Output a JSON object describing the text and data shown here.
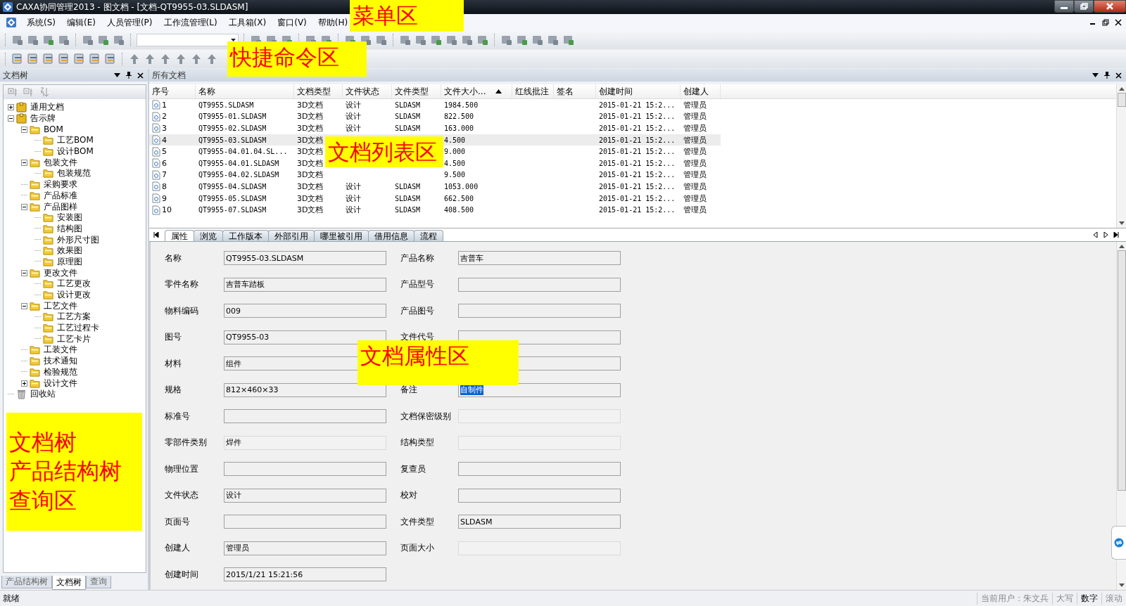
{
  "window": {
    "title": "CAXA协同管理2013 - 图文档 - [文档-QT9955-03.SLDASM]"
  },
  "menu": [
    "系统(S)",
    "编辑(E)",
    "人员管理(P)",
    "工作流管理(L)",
    "工具箱(X)",
    "窗口(V)",
    "帮助(H)"
  ],
  "left_panel": {
    "title": "文档树",
    "tree": [
      {
        "label": "通用文档",
        "kind": "cabinet",
        "expanded": false
      },
      {
        "label": "告示牌",
        "kind": "cabinet",
        "expanded": true,
        "children": [
          {
            "label": "BOM",
            "kind": "folder",
            "expanded": true,
            "children": [
              {
                "label": "工艺BOM",
                "kind": "folder"
              },
              {
                "label": "设计BOM",
                "kind": "folder"
              }
            ]
          },
          {
            "label": "包装文件",
            "kind": "folder",
            "expanded": true,
            "children": [
              {
                "label": "包装规范",
                "kind": "folder"
              }
            ]
          },
          {
            "label": "采购要求",
            "kind": "folder"
          },
          {
            "label": "产品标准",
            "kind": "folder"
          },
          {
            "label": "产品图样",
            "kind": "folder",
            "expanded": true,
            "children": [
              {
                "label": "安装图",
                "kind": "folder"
              },
              {
                "label": "结构图",
                "kind": "folder"
              },
              {
                "label": "外形尺寸图",
                "kind": "folder"
              },
              {
                "label": "效果图",
                "kind": "folder"
              },
              {
                "label": "原理图",
                "kind": "folder"
              }
            ]
          },
          {
            "label": "更改文件",
            "kind": "folder",
            "expanded": true,
            "children": [
              {
                "label": "工艺更改",
                "kind": "folder"
              },
              {
                "label": "设计更改",
                "kind": "folder"
              }
            ]
          },
          {
            "label": "工艺文件",
            "kind": "folder",
            "expanded": true,
            "children": [
              {
                "label": "工艺方案",
                "kind": "folder"
              },
              {
                "label": "工艺过程卡",
                "kind": "folder"
              },
              {
                "label": "工艺卡片",
                "kind": "folder"
              }
            ]
          },
          {
            "label": "工装文件",
            "kind": "folder"
          },
          {
            "label": "技术通知",
            "kind": "folder"
          },
          {
            "label": "检验规范",
            "kind": "folder"
          },
          {
            "label": "设计文件",
            "kind": "folder",
            "expanded": false
          }
        ]
      },
      {
        "label": "回收站",
        "kind": "trash"
      }
    ],
    "tabs": [
      {
        "label": "产品结构树",
        "selected": false
      },
      {
        "label": "文档树",
        "selected": true
      },
      {
        "label": "查询",
        "selected": false
      }
    ]
  },
  "documents": {
    "title": "所有文档",
    "columns": [
      "序号",
      "名称",
      "文档类型",
      "文件状态",
      "文件类型",
      "文件大小...",
      "红线批注",
      "签名",
      "创建时间",
      "创建人"
    ],
    "rows": [
      {
        "selected": false,
        "cells": [
          "1",
          "QT9955.SLDASM",
          "3D文档",
          "设计",
          "SLDASM",
          "1984.500",
          "",
          "",
          "2015-01-21 15:2...",
          "管理员"
        ]
      },
      {
        "selected": false,
        "cells": [
          "2",
          "QT9955-01.SLDASM",
          "3D文档",
          "设计",
          "SLDASM",
          "822.500",
          "",
          "",
          "2015-01-21 15:2...",
          "管理员"
        ]
      },
      {
        "selected": false,
        "cells": [
          "3",
          "QT9955-02.SLDASM",
          "3D文档",
          "设计",
          "SLDASM",
          "163.000",
          "",
          "",
          "2015-01-21 15:2...",
          "管理员"
        ]
      },
      {
        "selected": true,
        "cells": [
          "4",
          "QT9955-03.SLDASM",
          "3D文档",
          "",
          "",
          "4.500",
          "",
          "",
          "2015-01-21 15:2...",
          "管理员"
        ]
      },
      {
        "selected": false,
        "cells": [
          "5",
          "QT9955-04.01.04.SL...",
          "3D文档",
          "",
          "",
          "9.000",
          "",
          "",
          "2015-01-21 15:2...",
          "管理员"
        ]
      },
      {
        "selected": false,
        "cells": [
          "6",
          "QT9955-04.01.SLDASM",
          "3D文档",
          "",
          "",
          "4.500",
          "",
          "",
          "2015-01-21 15:2...",
          "管理员"
        ]
      },
      {
        "selected": false,
        "cells": [
          "7",
          "QT9955-04.02.SLDASM",
          "3D文档",
          "",
          "",
          "9.500",
          "",
          "",
          "2015-01-21 15:2...",
          "管理员"
        ]
      },
      {
        "selected": false,
        "cells": [
          "8",
          "QT9955-04.SLDASM",
          "3D文档",
          "设计",
          "SLDASM",
          "1053.000",
          "",
          "",
          "2015-01-21 15:2...",
          "管理员"
        ]
      },
      {
        "selected": false,
        "cells": [
          "9",
          "QT9955-05.SLDASM",
          "3D文档",
          "设计",
          "SLDASM",
          "662.500",
          "",
          "",
          "2015-01-21 15:2...",
          "管理员"
        ]
      },
      {
        "selected": false,
        "cells": [
          "10",
          "QT9955-07.SLDASM",
          "3D文档",
          "设计",
          "SLDASM",
          "408.500",
          "",
          "",
          "2015-01-21 15:2...",
          "管理员"
        ]
      }
    ]
  },
  "detail_tabs": [
    {
      "label": "属性",
      "selected": true
    },
    {
      "label": "浏览",
      "selected": false
    },
    {
      "label": "工作版本",
      "selected": false
    },
    {
      "label": "外部引用",
      "selected": false
    },
    {
      "label": "哪里被引用",
      "selected": false
    },
    {
      "label": "借用信息",
      "selected": false
    },
    {
      "label": "流程",
      "selected": false
    }
  ],
  "properties": [
    {
      "left": {
        "label": "名称",
        "value": "QT9955-03.SLDASM",
        "disabled": false
      },
      "right": {
        "label": "产品名称",
        "value": "吉普车",
        "disabled": false
      }
    },
    {
      "left": {
        "label": "零件名称",
        "value": "吉普车踏板",
        "disabled": false
      },
      "right": {
        "label": "产品型号",
        "disabled": false
      }
    },
    {
      "left": {
        "label": "物料编码",
        "value": "009",
        "disabled": false
      },
      "right": {
        "label": "产品图号",
        "disabled": false
      }
    },
    {
      "left": {
        "label": "图号",
        "value": "QT9955-03",
        "disabled": false
      },
      "right": {
        "label": "文件代号",
        "disabled": false
      }
    },
    {
      "left": {
        "label": "材料",
        "value": "组件",
        "disabled": false
      },
      "right": {
        "disabled": false
      }
    },
    {
      "left": {
        "label": "规格",
        "value": "812×460×33",
        "disabled": false
      },
      "right": {
        "label": "备注",
        "value": "自制件",
        "disabled": false,
        "highlighted": true
      }
    },
    {
      "left": {
        "label": "标准号",
        "disabled": false
      },
      "right": {
        "label": "文档保密级别",
        "disabled": true
      }
    },
    {
      "left": {
        "label": "零部件类别",
        "value": "焊件",
        "disabled": true
      },
      "right": {
        "label": "结构类型",
        "disabled": true
      }
    },
    {
      "left": {
        "label": "物理位置",
        "disabled": false
      },
      "right": {
        "label": "复查员",
        "disabled": false
      }
    },
    {
      "left": {
        "label": "文件状态",
        "value": "设计",
        "disabled": false
      },
      "right": {
        "label": "校对",
        "disabled": false
      }
    },
    {
      "left": {
        "label": "页面号",
        "disabled": false
      },
      "right": {
        "label": "文件类型",
        "value": "SLDASM",
        "disabled": false
      }
    },
    {
      "left": {
        "label": "创建人",
        "value": "管理员",
        "disabled": false
      },
      "right": {
        "label": "页面大小",
        "disabled": true
      }
    },
    {
      "left": {
        "label": "创建时间",
        "value": "2015/1/21 15:21:56",
        "disabled": false
      }
    }
  ],
  "status_bar": {
    "message": "就绪",
    "user": "当前用户：朱文兵",
    "indicators": [
      {
        "label": "大写",
        "on": false
      },
      {
        "label": "数字",
        "on": true
      },
      {
        "label": "滚动",
        "on": false
      }
    ]
  },
  "annotations": [
    {
      "lines": [
        "菜单区"
      ]
    },
    {
      "lines": [
        "快捷命令区"
      ]
    },
    {
      "lines": [
        "文档列表区"
      ]
    },
    {
      "lines": [
        "文档属性区"
      ]
    },
    {
      "lines": [
        "文档树",
        "产品结构树",
        "查询区"
      ]
    }
  ]
}
